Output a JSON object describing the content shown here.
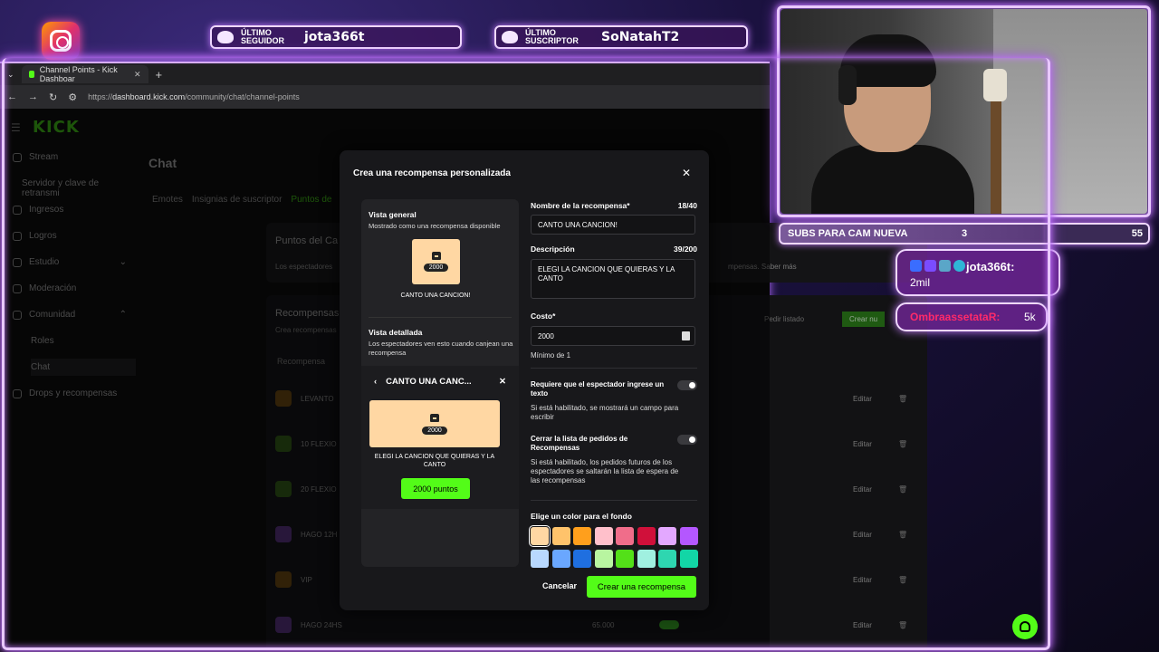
{
  "overlay": {
    "last_follower_label": "ÚLTIMO SEGUIDOR",
    "last_follower": "jota366t",
    "last_subscriber_label": "ÚLTIMO SUSCRIPTOR",
    "last_subscriber": "SoNatahT2",
    "goal_label": "SUBS PARA CAM NUEVA",
    "goal_current": "3",
    "goal_target": "55",
    "chat": [
      {
        "user": "jota366t:",
        "message": "2mil"
      },
      {
        "user": "OmbraassetataR:",
        "message": "5k"
      }
    ]
  },
  "browser": {
    "tab_title": "Channel Points - Kick Dashboar",
    "tab_close": "✕",
    "new_tab": "+",
    "url_prefix": "https://",
    "url_host": "dashboard.kick.com",
    "url_path": "/community/chat/channel-points"
  },
  "sidebar": {
    "logo": "KICK",
    "items": [
      {
        "label": "Stream"
      },
      {
        "label": "Servidor y clave de retransmi"
      },
      {
        "label": "Ingresos"
      },
      {
        "label": "Logros"
      },
      {
        "label": "Estudio"
      },
      {
        "label": "Moderación"
      },
      {
        "label": "Comunidad"
      },
      {
        "label": "Roles"
      },
      {
        "label": "Chat"
      },
      {
        "label": "Drops y recompensas"
      }
    ]
  },
  "page": {
    "title": "Chat",
    "tabs": [
      "Emotes",
      "Insignias de suscriptor",
      "Puntos de"
    ],
    "points_title": "Puntos del Ca",
    "points_desc": "Los espectadores",
    "points_desc_right": "mpensas. Saber más",
    "rewards_title": "Recompensas",
    "rewards_sub": "Crea recompensas",
    "rewards_col": "Recompensa",
    "request_list": "Pedir listado",
    "create_new": "Crear nu",
    "rows": [
      {
        "name": "LEVANTO"
      },
      {
        "name": "10 FLEXIO"
      },
      {
        "name": "20 FLEXIO"
      },
      {
        "name": "HAGO 12H"
      },
      {
        "name": "VIP"
      },
      {
        "name": "HAGO 24HS",
        "cost": "65.000"
      }
    ],
    "edit_label": "Editar"
  },
  "modal": {
    "title": "Crea una recompensa personalizada",
    "overview_title": "Vista general",
    "overview_desc": "Mostrado como una recompensa disponible",
    "card_cost": "2000",
    "card_name": "CANTO UNA CANCION!",
    "detail_title": "Vista detallada",
    "detail_desc": "Los espectadores ven esto cuando canjean una recompensa",
    "detail_header": "CANTO UNA CANC...",
    "detail_text": "ELEGI LA CANCION QUE QUIERAS Y LA CANTO",
    "points_button": "2000 puntos",
    "name_label": "Nombre de la recompensa*",
    "name_count": "18/40",
    "name_value": "CANTO UNA CANCION!",
    "desc_label": "Descripción",
    "desc_count": "39/200",
    "desc_value": "ELEGI LA CANCION QUE QUIERAS Y LA CANTO",
    "cost_label": "Costo*",
    "cost_value": "2000",
    "cost_min": "Mínimo de 1",
    "require_text_label": "Requiere que el espectador ingrese un texto",
    "require_text_note": "Si está habilitado, se mostrará un campo para escribir",
    "close_list_label": "Cerrar la lista de pedidos de Recompensas",
    "close_list_note": "Si está habilitado, los pedidos futuros de los espectadores se saltarán la lista de espera de las recompensas",
    "color_label": "Elige un color para el fondo",
    "colors_row1": [
      "#ffd7a3",
      "#ffc36b",
      "#ff9f1c",
      "#ffc0cb",
      "#f06d8a",
      "#d0103a",
      "#e3a8ff",
      "#b457ff"
    ],
    "colors_row2": [
      "#b8d8ff",
      "#6aa7ff",
      "#1f6fe0",
      "#b8f5a0",
      "#53e018",
      "#a0f0e0",
      "#2ed6b0",
      "#12d6a6"
    ],
    "selected_color": "#ffd7a3",
    "cancel": "Cancelar",
    "create": "Crear una recompensa"
  }
}
